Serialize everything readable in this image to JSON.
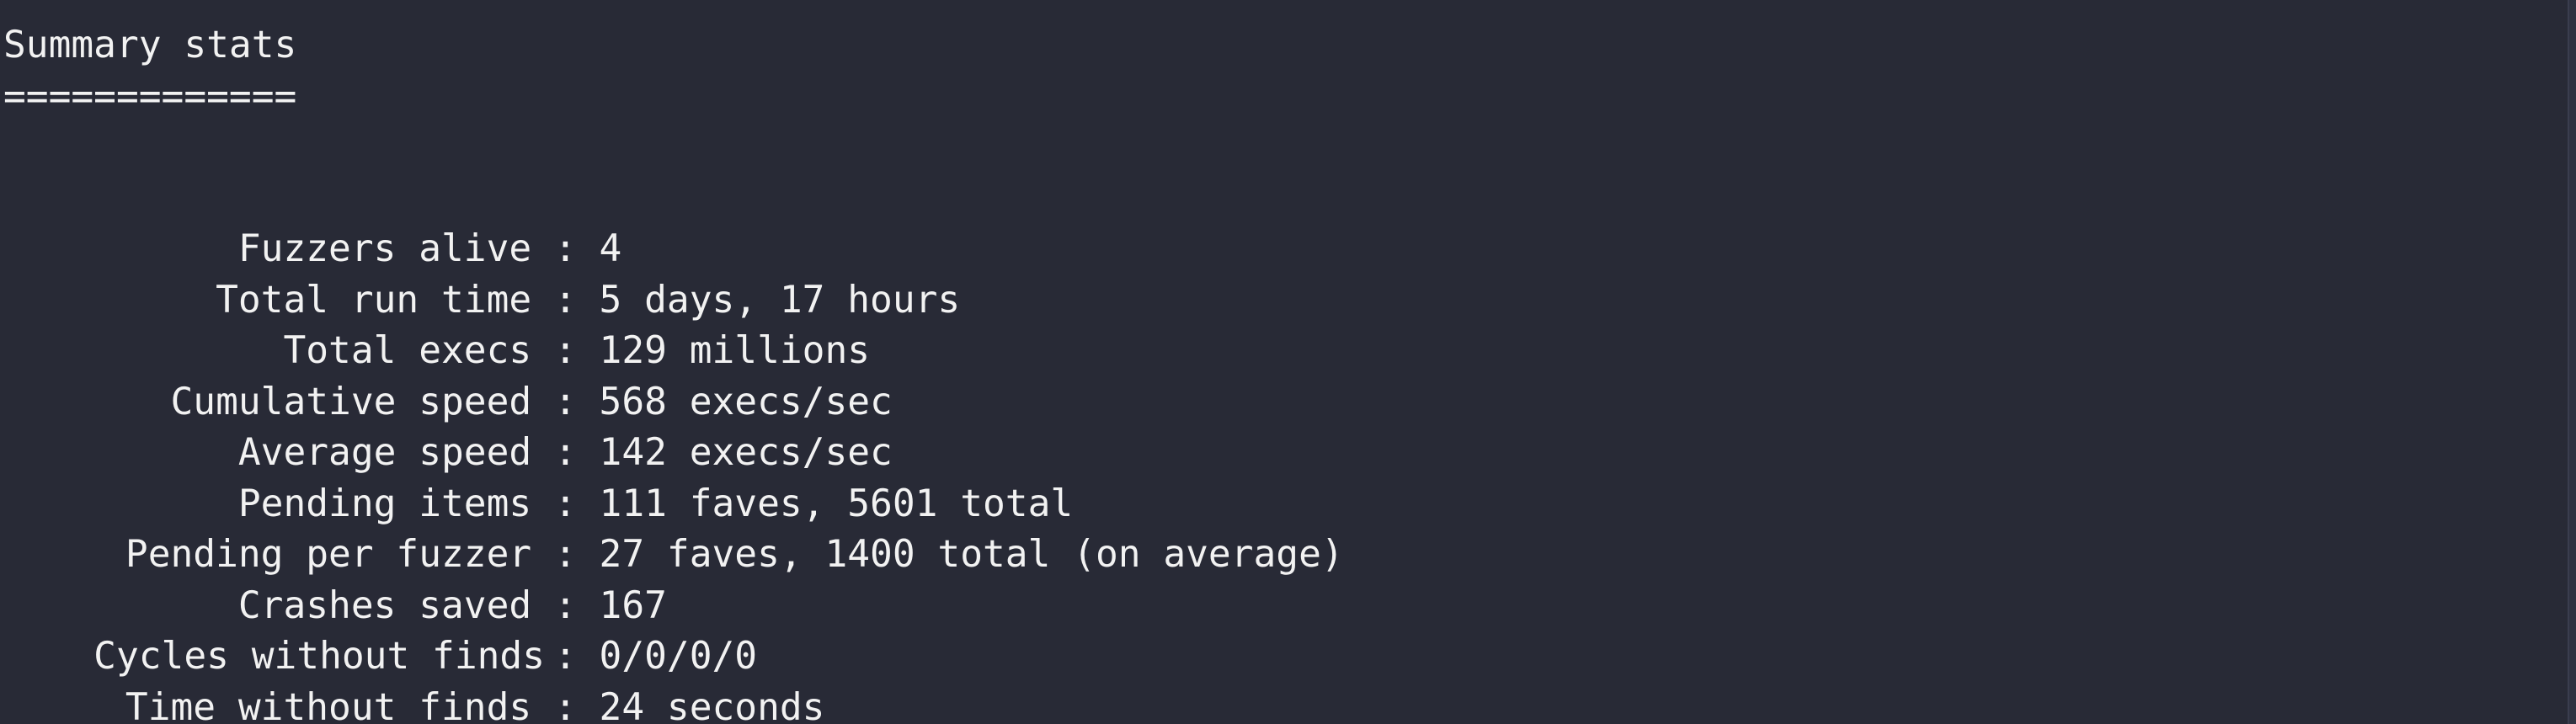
{
  "summary": {
    "title": "Summary stats",
    "underline": "============="
  },
  "stats": [
    {
      "label": "Fuzzers alive",
      "value": "4"
    },
    {
      "label": "Total run time",
      "value": "5 days, 17 hours"
    },
    {
      "label": "Total execs",
      "value": "129 millions"
    },
    {
      "label": "Cumulative speed",
      "value": "568 execs/sec"
    },
    {
      "label": "Average speed",
      "value": "142 execs/sec"
    },
    {
      "label": "Pending items",
      "value": "111 faves, 5601 total"
    },
    {
      "label": "Pending per fuzzer",
      "value": "27 faves, 1400 total (on average)"
    },
    {
      "label": "Crashes saved",
      "value": "167"
    },
    {
      "label": "Cycles without finds",
      "value": "0/0/0/0"
    },
    {
      "label": "Time without finds",
      "value": "24 seconds"
    }
  ],
  "separator": " : ",
  "colors": {
    "background": "#282a36",
    "foreground": "#f2f2f2"
  }
}
